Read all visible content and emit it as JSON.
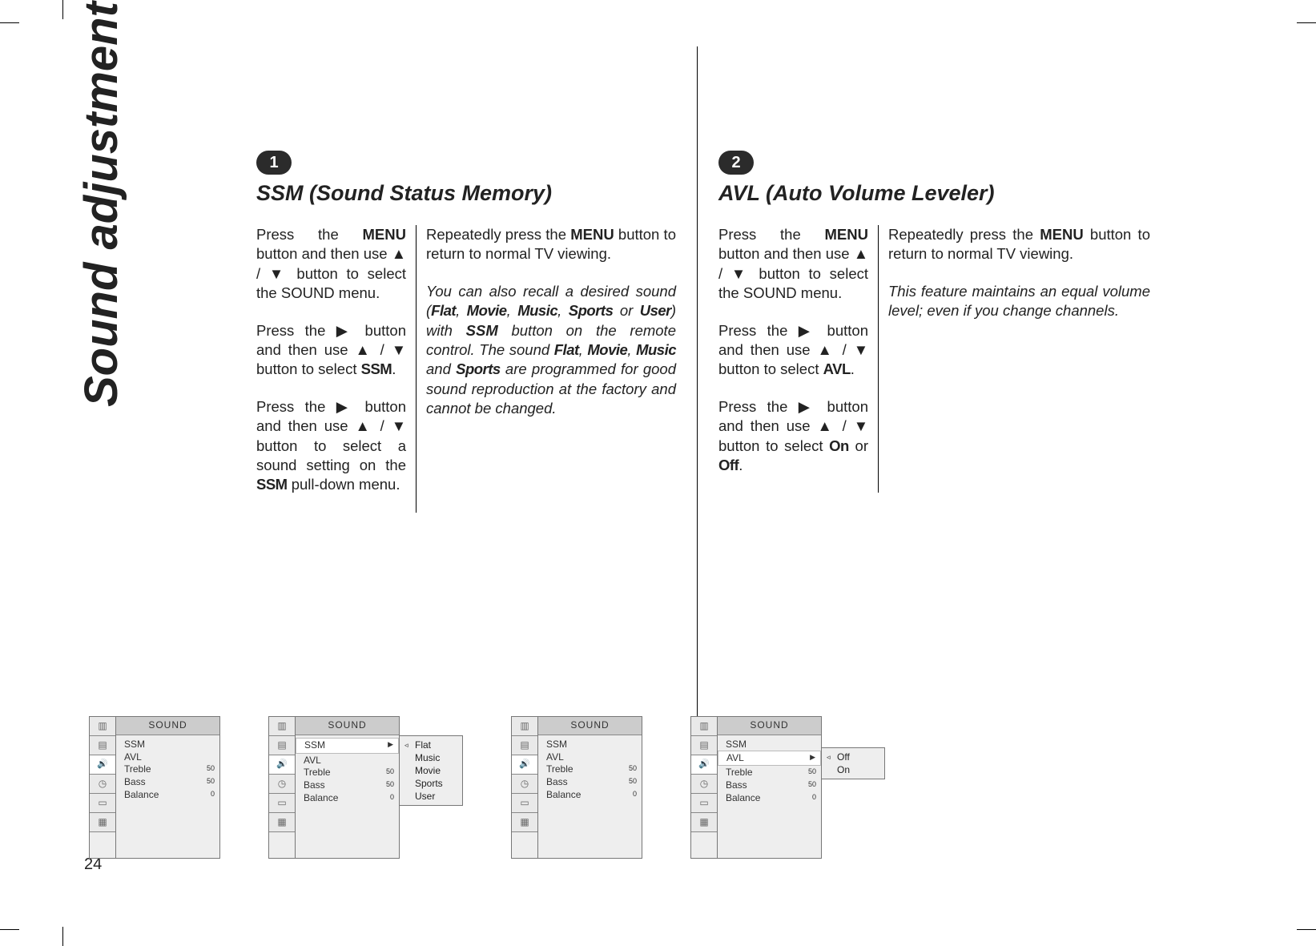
{
  "sidebar_title": "Sound adjustment",
  "page_number": "24",
  "glyphs": {
    "up": "▲",
    "down": "▼",
    "right": "▶",
    "left_hollow": "◃"
  },
  "sections": [
    {
      "badge": "1",
      "title": "SSM (Sound Status Memory)",
      "left_paragraphs": [
        {
          "runs": [
            {
              "t": "Press the "
            },
            {
              "t": "MENU",
              "cls": "b"
            },
            {
              "t": " button and then use "
            },
            {
              "t": "▲",
              "cls": "tri"
            },
            {
              "t": " / "
            },
            {
              "t": "▼",
              "cls": "tri"
            },
            {
              "t": " button to select the SOUND menu."
            }
          ]
        },
        {
          "runs": [
            {
              "t": "Press the "
            },
            {
              "t": "▶",
              "cls": "tri"
            },
            {
              "t": " button and then use "
            },
            {
              "t": "▲",
              "cls": "tri"
            },
            {
              "t": " / "
            },
            {
              "t": "▼",
              "cls": "tri"
            },
            {
              "t": " button to select "
            },
            {
              "t": "SSM",
              "cls": "heavy"
            },
            {
              "t": "."
            }
          ]
        },
        {
          "runs": [
            {
              "t": "Press the "
            },
            {
              "t": "▶",
              "cls": "tri"
            },
            {
              "t": " button and then use "
            },
            {
              "t": "▲",
              "cls": "tri"
            },
            {
              "t": " / "
            },
            {
              "t": "▼",
              "cls": "tri"
            },
            {
              "t": " button to select a sound setting on the "
            },
            {
              "t": "SSM",
              "cls": "heavy"
            },
            {
              "t": " pull-down menu."
            }
          ]
        }
      ],
      "right_paragraphs": [
        {
          "runs": [
            {
              "t": "Repeatedly press the "
            },
            {
              "t": "MENU",
              "cls": "b"
            },
            {
              "t": " but­ton to return to normal TV viewing."
            }
          ]
        },
        {
          "cls": "ital",
          "runs": [
            {
              "t": "You can also recall a desired sound ("
            },
            {
              "t": "Flat",
              "cls": "heavy"
            },
            {
              "t": ", "
            },
            {
              "t": "Movie",
              "cls": "heavy"
            },
            {
              "t": ", "
            },
            {
              "t": "Music",
              "cls": "heavy"
            },
            {
              "t": ", "
            },
            {
              "t": "Sports",
              "cls": "heavy"
            },
            {
              "t": " or "
            },
            {
              "t": "User",
              "cls": "heavy"
            },
            {
              "t": ") with "
            },
            {
              "t": "SSM",
              "cls": "b"
            },
            {
              "t": " button on the remote control. The sound "
            },
            {
              "t": "Flat",
              "cls": "heavy"
            },
            {
              "t": ", "
            },
            {
              "t": "Movie",
              "cls": "heavy"
            },
            {
              "t": ", "
            },
            {
              "t": "Music",
              "cls": "heavy"
            },
            {
              "t": " and "
            },
            {
              "t": "Sports",
              "cls": "heavy"
            },
            {
              "t": " are programmed for good sound reproduction at the factory and cannot be changed."
            }
          ]
        }
      ]
    },
    {
      "badge": "2",
      "title": "AVL (Auto Volume Leveler)",
      "left_paragraphs": [
        {
          "runs": [
            {
              "t": "Press the "
            },
            {
              "t": "MENU",
              "cls": "b"
            },
            {
              "t": " button and then use "
            },
            {
              "t": "▲",
              "cls": "tri"
            },
            {
              "t": " / "
            },
            {
              "t": "▼",
              "cls": "tri"
            },
            {
              "t": " button to select the SOUND menu."
            }
          ]
        },
        {
          "runs": [
            {
              "t": "Press the "
            },
            {
              "t": "▶",
              "cls": "tri"
            },
            {
              "t": "  button and then use "
            },
            {
              "t": "▲",
              "cls": "tri"
            },
            {
              "t": " / "
            },
            {
              "t": "▼",
              "cls": "tri"
            },
            {
              "t": " button to select "
            },
            {
              "t": "AVL",
              "cls": "heavy"
            },
            {
              "t": "."
            }
          ]
        },
        {
          "runs": [
            {
              "t": "Press the "
            },
            {
              "t": "▶",
              "cls": "tri"
            },
            {
              "t": "  button and then use "
            },
            {
              "t": "▲",
              "cls": "tri"
            },
            {
              "t": " / "
            },
            {
              "t": "▼",
              "cls": "tri"
            },
            {
              "t": " button to select "
            },
            {
              "t": "On",
              "cls": "heavy"
            },
            {
              "t": " or "
            },
            {
              "t": "Off",
              "cls": "heavy"
            },
            {
              "t": "."
            }
          ]
        }
      ],
      "right_paragraphs": [
        {
          "runs": [
            {
              "t": "Repeatedly press the "
            },
            {
              "t": "MENU",
              "cls": "b"
            },
            {
              "t": " but­ton to return to normal TV viewing."
            }
          ]
        },
        {
          "cls": "ital",
          "runs": [
            {
              "t": "This feature maintains an equal volume level; even if you change channels."
            }
          ]
        }
      ]
    }
  ],
  "osd": {
    "header": "SOUND",
    "icons": [
      "bars",
      "bars2",
      "speaker",
      "clock",
      "tool",
      "grid",
      "blank"
    ],
    "base_rows": [
      {
        "label": "SSM",
        "value": ""
      },
      {
        "label": "AVL",
        "value": ""
      },
      {
        "label": "Treble",
        "value": "50"
      },
      {
        "label": "Bass",
        "value": "50"
      },
      {
        "label": "Balance",
        "value": "0"
      }
    ],
    "menus": [
      {
        "highlight": null,
        "popup": null
      },
      {
        "highlight": 0,
        "arrow_row": 0,
        "popup": {
          "selected": 0,
          "options": [
            "Flat",
            "Music",
            "Movie",
            "Sports",
            "User"
          ]
        }
      },
      {
        "highlight": null,
        "popup": null
      },
      {
        "highlight": 1,
        "arrow_row": 1,
        "popup": {
          "selected": 0,
          "options": [
            "Off",
            "On"
          ]
        }
      }
    ]
  }
}
